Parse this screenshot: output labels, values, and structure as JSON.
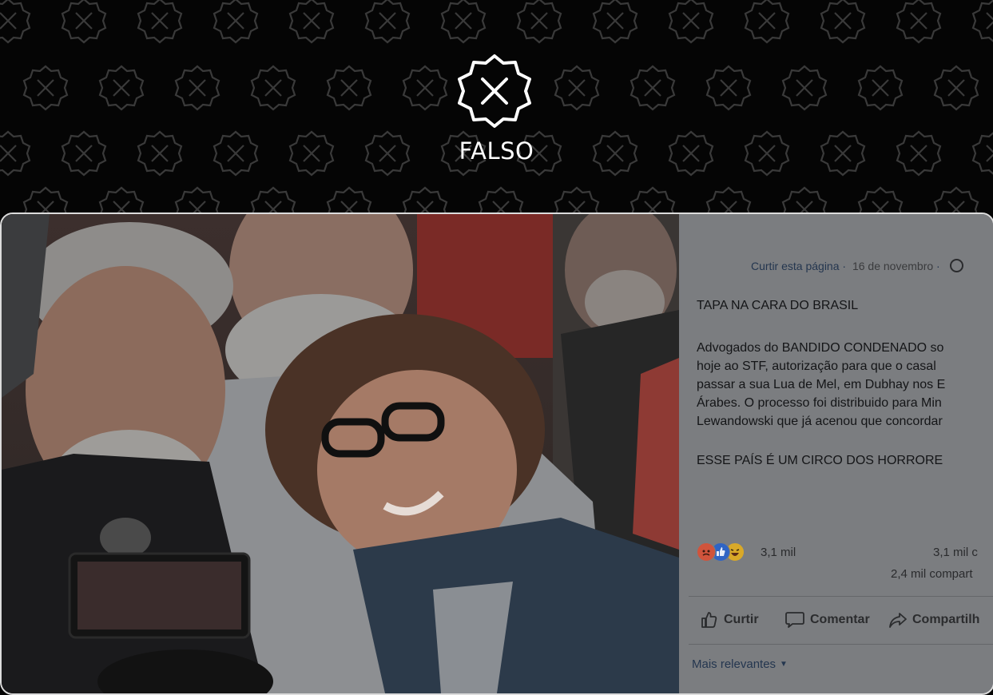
{
  "verdict": {
    "label": "FALSO",
    "stamp_icon": "x-seal-icon"
  },
  "facebook_post": {
    "like_page": "Curtir esta página",
    "date_separator": "·",
    "date": "16 de novembro",
    "date_separator_2": "·",
    "title": "TAPA NA CARA DO BRASIL",
    "body_lines": [
      "Advogados do BANDIDO CONDENADO so",
      "hoje ao STF, autorização para que o casal",
      "passar a sua Lua de Mel, em Dubhay nos E",
      "Árabes. O processo foi distribuido para Min",
      "Lewandowski que já acenou que concordar"
    ],
    "closing": "ESSE PAÍS É UM CIRCO DOS HORRORE",
    "reactions": {
      "icons": [
        "angry-react-icon",
        "like-react-icon",
        "haha-react-icon"
      ],
      "count": "3,1 mil"
    },
    "comments_count": "3,1 mil c",
    "shares_count": "2,4 mil compart",
    "actions": {
      "like": "Curtir",
      "comment": "Comentar",
      "share": "Compartilh"
    },
    "sort_label": "Mais relevantes"
  },
  "colors": {
    "background": "#050505",
    "panel": "#7b7d80",
    "link": "#24364f"
  }
}
